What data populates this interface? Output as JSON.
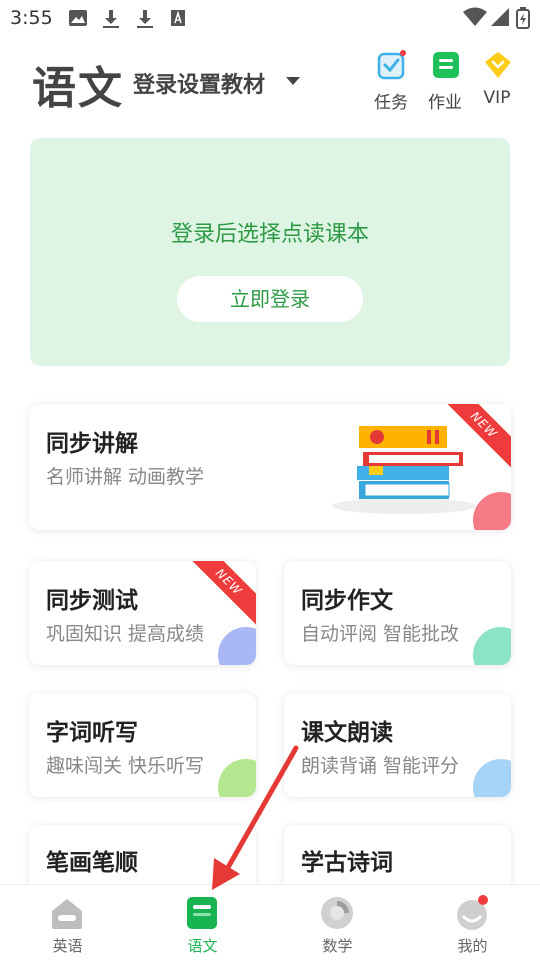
{
  "status_bar": {
    "time": "3:55"
  },
  "header": {
    "title": "语文",
    "subtitle": "登录设置教材",
    "buttons": [
      {
        "label": "任务",
        "icon": "task-checkbox-icon"
      },
      {
        "label": "作业",
        "icon": "homework-icon"
      },
      {
        "label": "VIP",
        "icon": "vip-diamond-icon"
      }
    ]
  },
  "banner": {
    "text": "登录后选择点读课本",
    "button_label": "立即登录"
  },
  "features": [
    {
      "title": "同步讲解",
      "subtitle": "名师讲解  动画教学",
      "badge": "NEW"
    },
    {
      "title": "同步测试",
      "subtitle": "巩固知识 提高成绩",
      "badge": "NEW"
    },
    {
      "title": "同步作文",
      "subtitle": "自动评阅  智能批改"
    },
    {
      "title": "字词听写",
      "subtitle": "趣味闯关 快乐听写"
    },
    {
      "title": "课文朗读",
      "subtitle": "朗读背诵 智能评分"
    },
    {
      "title": "笔画笔顺",
      "subtitle": ""
    },
    {
      "title": "学古诗词",
      "subtitle": ""
    }
  ],
  "bottom_nav": [
    {
      "label": "英语",
      "icon": "home-icon"
    },
    {
      "label": "语文",
      "icon": "book-icon",
      "active": true
    },
    {
      "label": "数学",
      "icon": "math-icon"
    },
    {
      "label": "我的",
      "icon": "profile-icon"
    }
  ],
  "colors": {
    "accent": "#18b452",
    "banner_bg": "#dff5e4",
    "new_badge": "#ee3b3b",
    "arrow": "#e53935"
  }
}
